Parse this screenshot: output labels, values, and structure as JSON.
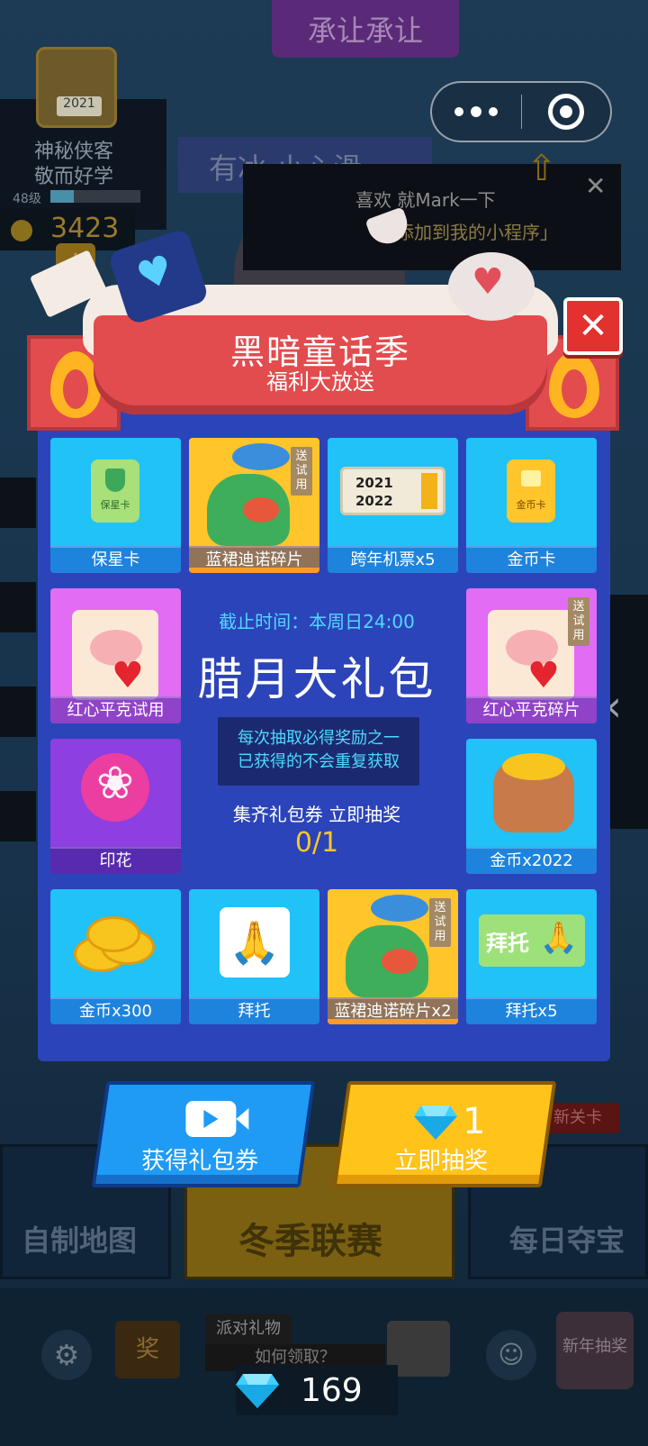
{
  "background": {
    "top_banner": "承让承让",
    "user": {
      "name": "神秘侠客",
      "motto": "敬而好学",
      "level": "48级",
      "level_progress": 0.26,
      "coins": "3423",
      "avatar_year": "2021"
    },
    "slip_notice": "有冰 小心滑",
    "tip_line1": "喜欢 就Mark一下",
    "tip_line2": "添加到我的小程序」",
    "modes": {
      "left": "自制地图",
      "middle": "冬季联赛",
      "right": "每日夺宝",
      "new_level_badge": "新关卡"
    },
    "bottom": {
      "party_gift": "派对礼物",
      "how_get": "如何领取？",
      "tv_badge": "奖",
      "new_year": "新年抽奖"
    },
    "gem_balance": "169"
  },
  "modal": {
    "title": "黑暗童话季",
    "subtitle": "福利大放送",
    "deadline": "截止时间：本周日24:00",
    "main_title": "腊月大礼包",
    "rule_line1": "每次抽取必得奖励之一",
    "rule_line2": "已获得的不会重复获取",
    "collect_text": "集齐礼包券 立即抽奖",
    "progress": "0/1",
    "trial_tag": "送试用",
    "tiles": [
      {
        "label": "保星卡",
        "icon": "star-protect-card-icon",
        "card_text": "保星卡"
      },
      {
        "label": "蓝裙迪诺碎片",
        "icon": "dino-icon"
      },
      {
        "label": "跨年机票x5",
        "icon": "ticket-icon",
        "ticket_text1": "2021",
        "ticket_text2": "2022"
      },
      {
        "label": "金币卡",
        "icon": "gold-card-icon",
        "card_text": "金币卡"
      },
      {
        "label": "红心平克试用",
        "icon": "pig-card-icon"
      },
      {
        "label": "红心平克碎片",
        "icon": "pig-card-icon"
      },
      {
        "label": "印花",
        "icon": "lotus-icon"
      },
      {
        "label": "金币x2022",
        "icon": "coin-bag-icon"
      },
      {
        "label": "金币x300",
        "icon": "coins-icon"
      },
      {
        "label": "拜托",
        "icon": "pray-icon"
      },
      {
        "label": "蓝裙迪诺碎片x2",
        "icon": "dino-icon"
      },
      {
        "label": "拜托x5",
        "icon": "pray-card-icon",
        "card_text": "拜托"
      }
    ],
    "get_coupon_label": "获得礼包券",
    "draw_label": "立即抽奖",
    "draw_cost": "1"
  },
  "colors": {
    "modal_bg": "#2c44b9",
    "tile_cyan": "#20c2f7",
    "tile_yellow": "#ffc52b",
    "tile_pink": "#e26cf4",
    "tile_purple": "#8d3fe0",
    "accent_cyan": "#4fd8ff",
    "progress_yellow": "#ffc52b",
    "close_red": "#e2312f"
  }
}
